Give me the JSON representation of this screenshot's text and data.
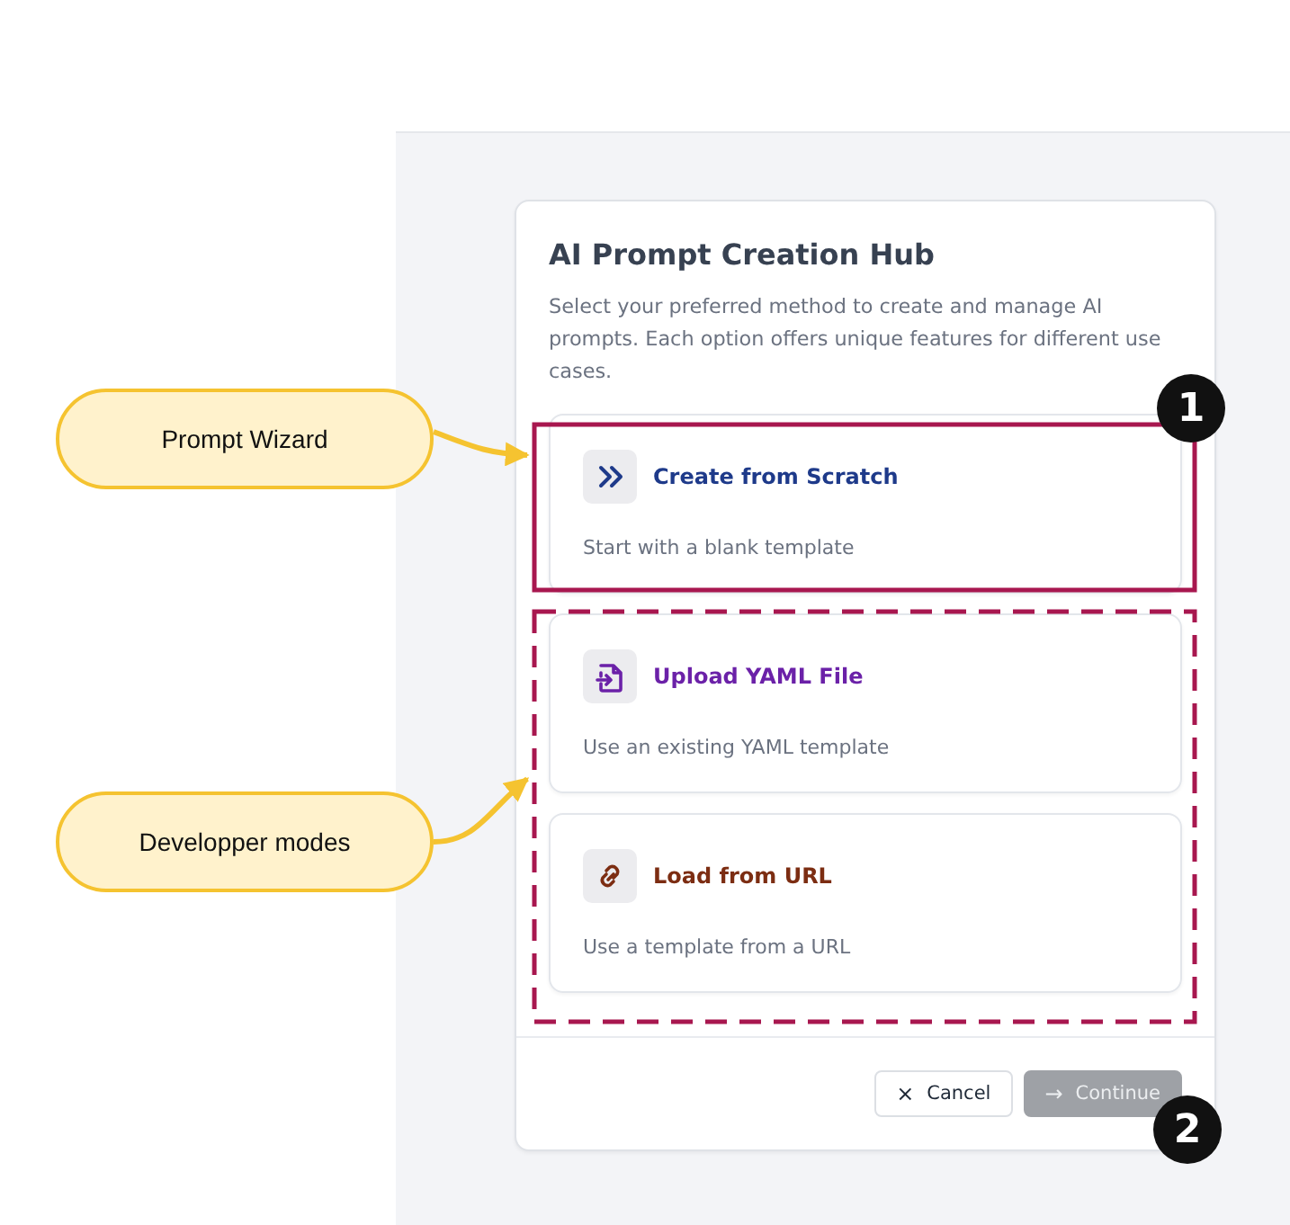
{
  "dialog": {
    "title": "AI Prompt Creation Hub",
    "description": "Select your preferred method to create and manage AI prompts. Each option offers unique features for different use cases.",
    "options": [
      {
        "kind": "chevrons",
        "title": "Create from Scratch",
        "description": "Start with a blank template",
        "color": "#1e3a8a"
      },
      {
        "kind": "file-import",
        "title": "Upload YAML File",
        "description": "Use an existing YAML template",
        "color": "#6b21a8"
      },
      {
        "kind": "link",
        "title": "Load from URL",
        "description": "Use a template from a URL",
        "color": "#7c2d12"
      }
    ],
    "buttons": [
      {
        "kind": "cancel",
        "icon": "×",
        "label": "Cancel",
        "disabled": false
      },
      {
        "kind": "continue",
        "icon": "→",
        "label": "Continue",
        "disabled": true
      }
    ]
  },
  "annotations": {
    "callouts": [
      {
        "label": "Prompt Wizard"
      },
      {
        "label": "Developper modes"
      }
    ],
    "frames": [
      {
        "kind": "solid"
      },
      {
        "kind": "dashed"
      }
    ],
    "badges": [
      {
        "number": "1"
      },
      {
        "number": "2"
      }
    ]
  }
}
